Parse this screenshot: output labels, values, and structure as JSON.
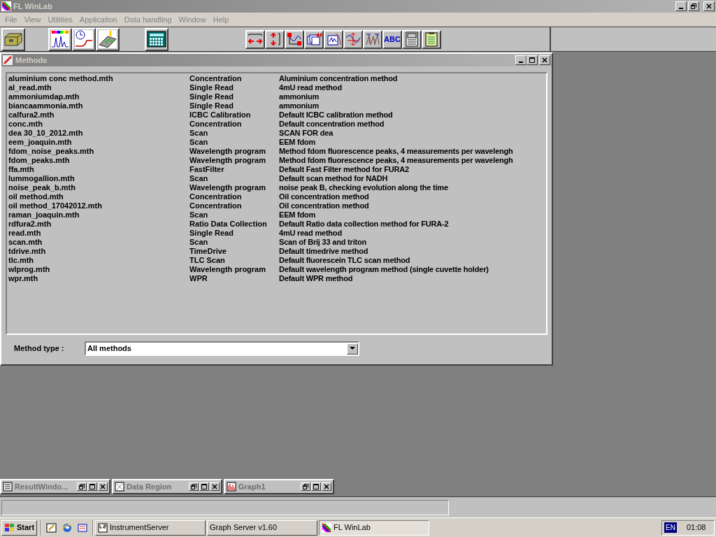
{
  "window": {
    "title": "FL WinLab",
    "active": false
  },
  "menu": [
    "File",
    "View",
    "Utilities",
    "Application",
    "Data handling",
    "Window",
    "Help"
  ],
  "toolbar_left": [
    {
      "kind": "instrument"
    },
    {
      "kind": "spectrum"
    },
    {
      "kind": "timecurve"
    },
    {
      "kind": "plate"
    },
    {
      "kind": "calculator"
    }
  ],
  "toolbar_right": [
    {
      "kind": "hexpand"
    },
    {
      "kind": "vexpand"
    },
    {
      "kind": "axes"
    },
    {
      "kind": "overlay"
    },
    {
      "kind": "peaks"
    },
    {
      "kind": "crosshair"
    },
    {
      "kind": "markers"
    },
    {
      "kind": "text",
      "label": "ABC"
    },
    {
      "kind": "report"
    },
    {
      "kind": "clipboard"
    }
  ],
  "methods_window": {
    "title": "Methods",
    "rows": [
      {
        "name": "aluminium conc method.mth",
        "type": "Concentration",
        "description": "Aluminium concentration method"
      },
      {
        "name": "al_read.mth",
        "type": "Single Read",
        "description": "4mU read method"
      },
      {
        "name": "ammoniumdap.mth",
        "type": "Single Read",
        "description": "ammonium"
      },
      {
        "name": "biancaammonia.mth",
        "type": "Single Read",
        "description": "ammonium"
      },
      {
        "name": "calfura2.mth",
        "type": "ICBC Calibration",
        "description": "Default ICBC calibration method"
      },
      {
        "name": "conc.mth",
        "type": "Concentration",
        "description": "Default concentration method"
      },
      {
        "name": "dea 30_10_2012.mth",
        "type": "Scan",
        "description": "SCAN FOR dea"
      },
      {
        "name": "eem_joaquin.mth",
        "type": "Scan",
        "description": "EEM fdom"
      },
      {
        "name": "fdom_noise_peaks.mth",
        "type": "Wavelength program",
        "description": "Method fdom fluorescence peaks, 4 measurements per wavelengh"
      },
      {
        "name": "fdom_peaks.mth",
        "type": "Wavelength program",
        "description": "Method fdom fluorescence peaks, 4 measurements per wavelengh"
      },
      {
        "name": "ffa.mth",
        "type": "FastFilter",
        "description": "Default Fast Filter method for FURA2"
      },
      {
        "name": "lummogallion.mth",
        "type": "Scan",
        "description": "Default scan method for NADH"
      },
      {
        "name": "noise_peak_b.mth",
        "type": "Wavelength program",
        "description": "noise peak B, checking evolution along the time"
      },
      {
        "name": "oil method.mth",
        "type": "Concentration",
        "description": "Oil concentration method"
      },
      {
        "name": "oil method_17042012.mth",
        "type": "Concentration",
        "description": "Oil concentration method"
      },
      {
        "name": "raman_joaquin.mth",
        "type": "Scan",
        "description": "EEM fdom"
      },
      {
        "name": "rdfura2.mth",
        "type": "Ratio Data Collection",
        "description": "Default Ratio data collection method for FURA-2"
      },
      {
        "name": "read.mth",
        "type": "Single Read",
        "description": "4mU read method"
      },
      {
        "name": "scan.mth",
        "type": "Scan",
        "description": "Scan of Brij 33 and triton"
      },
      {
        "name": "tdrive.mth",
        "type": "TimeDrive",
        "description": "Default timedrive method"
      },
      {
        "name": "tlc.mth",
        "type": "TLC Scan",
        "description": "Default fluorescein TLC scan method"
      },
      {
        "name": "wlprog.mth",
        "type": "Wavelength program",
        "description": "Default wavelength program method (single cuvette holder)"
      },
      {
        "name": "wpr.mth",
        "type": "WPR",
        "description": "Default WPR method"
      }
    ],
    "method_type_label": "Method type :",
    "method_type_value": "All methods"
  },
  "minimized_windows": [
    {
      "title": "ResultWindo...",
      "kind": "text"
    },
    {
      "title": "Data Region",
      "kind": "data"
    },
    {
      "title": "Graph1",
      "kind": "graph"
    }
  ],
  "taskbar": {
    "start": "Start",
    "tasks": [
      {
        "label": "InstrumentServer",
        "kind": "ls",
        "selected": false
      },
      {
        "label": "Graph Server v1.60",
        "kind": "none",
        "selected": false
      },
      {
        "label": "FL WinLab",
        "kind": "winlab",
        "selected": true
      }
    ],
    "language": "EN",
    "clock": "01:08"
  }
}
